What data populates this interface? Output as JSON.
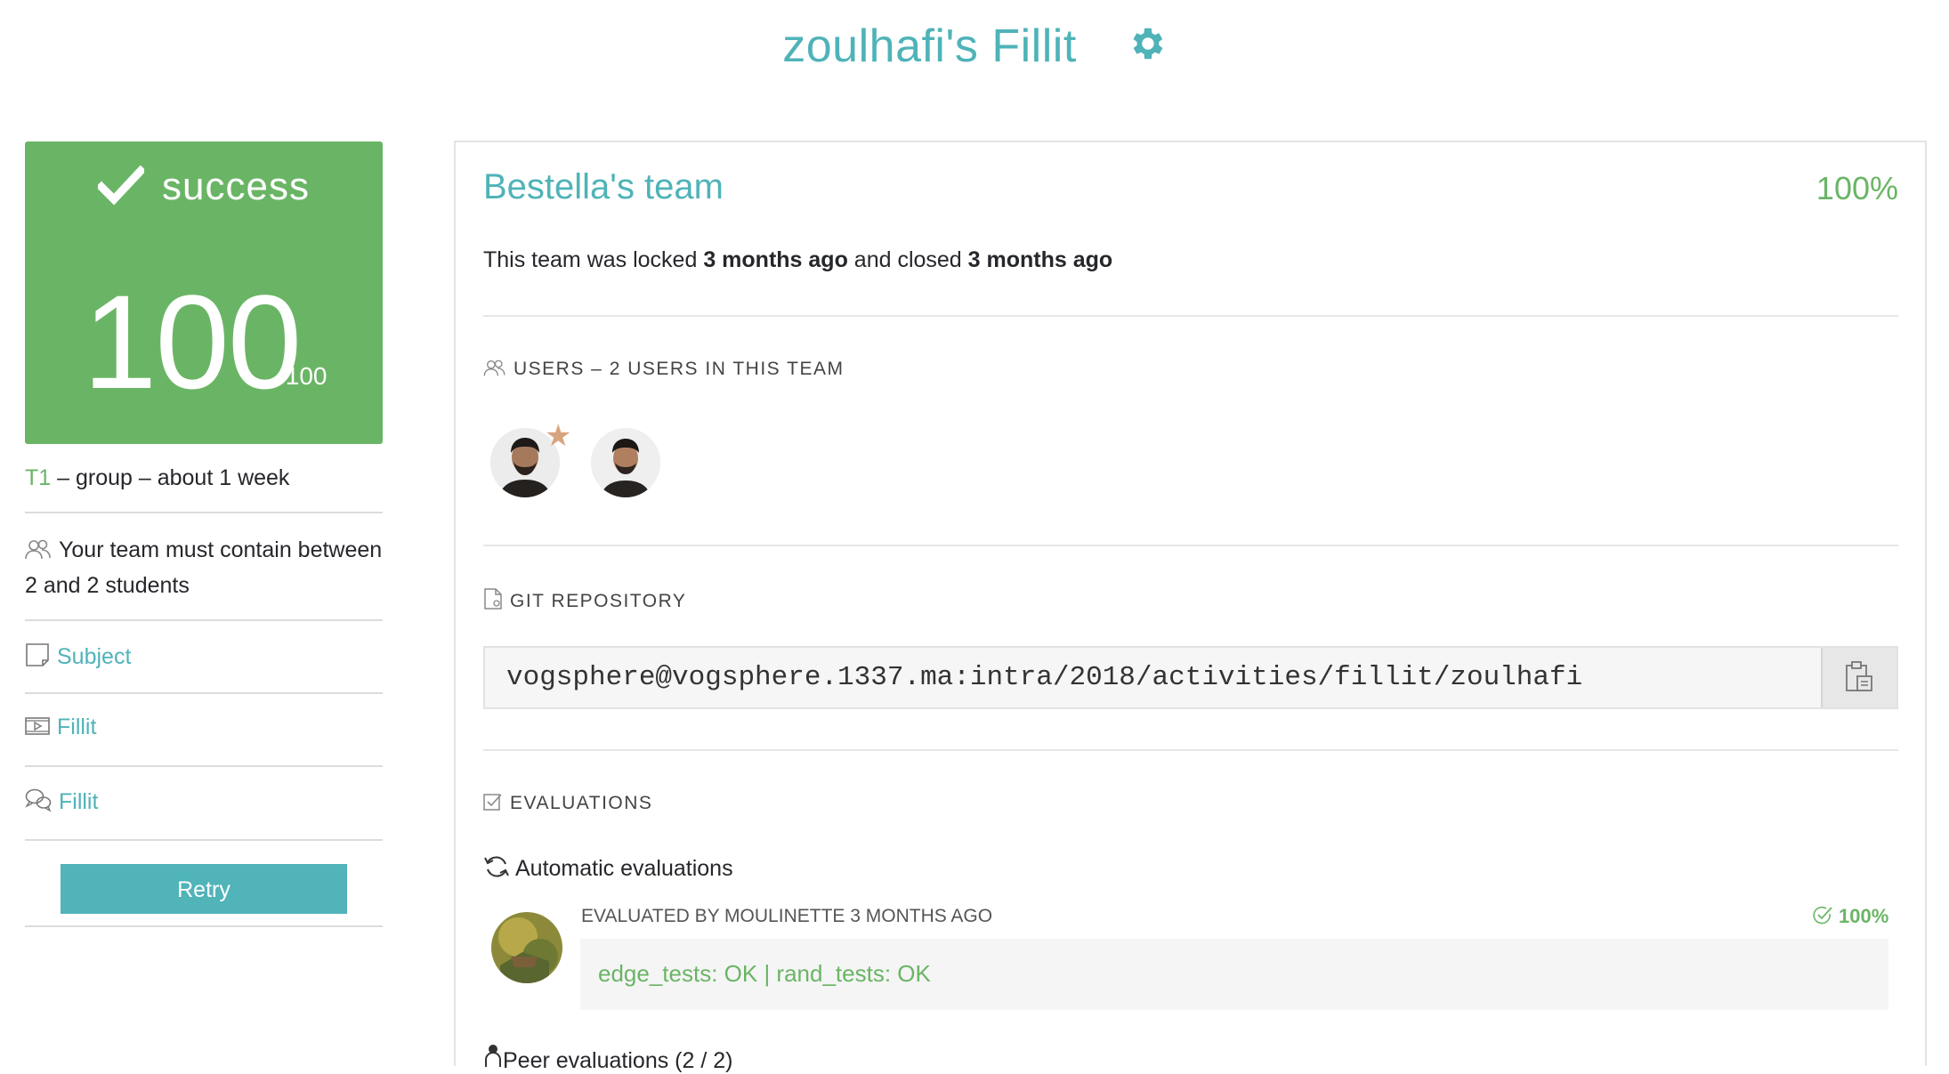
{
  "header": {
    "title": "zoulhafi's Fillit",
    "gear_icon": "gear-icon"
  },
  "score": {
    "status": "success",
    "value": "100",
    "max": "/100"
  },
  "project_meta": {
    "tier": "T1",
    "rest": " – group – about 1 week"
  },
  "sidebar": {
    "team_size": "Your team must contain between 2 and 2 students",
    "subject_link": "Subject",
    "video_link": "Fillit",
    "forum_link": "Fillit",
    "retry_label": "Retry"
  },
  "team": {
    "name": "Bestella's team",
    "percent": "100%",
    "lock_prefix": "This team was locked ",
    "lock_time": "3 months ago",
    "lock_mid": " and closed ",
    "close_time": "3 months ago"
  },
  "users": {
    "label": "USERS – 2 USERS IN THIS TEAM",
    "star": "★"
  },
  "git": {
    "label": "GIT REPOSITORY",
    "repo": "vogsphere@vogsphere.1337.ma:intra/2018/activities/fillit/zoulhafi"
  },
  "evaluations": {
    "label": "EVALUATIONS",
    "automatic_title": "Automatic evaluations",
    "evaluated_by": "EVALUATED BY MOULINETTE 3 MONTHS AGO",
    "eval_percent": "100%",
    "result": "edge_tests: OK | rand_tests: OK",
    "peer_title": "Peer evaluations (2 / 2)"
  },
  "colors": {
    "accent": "#4fb3b8",
    "success": "#6ab565",
    "star": "#d8a47f"
  }
}
